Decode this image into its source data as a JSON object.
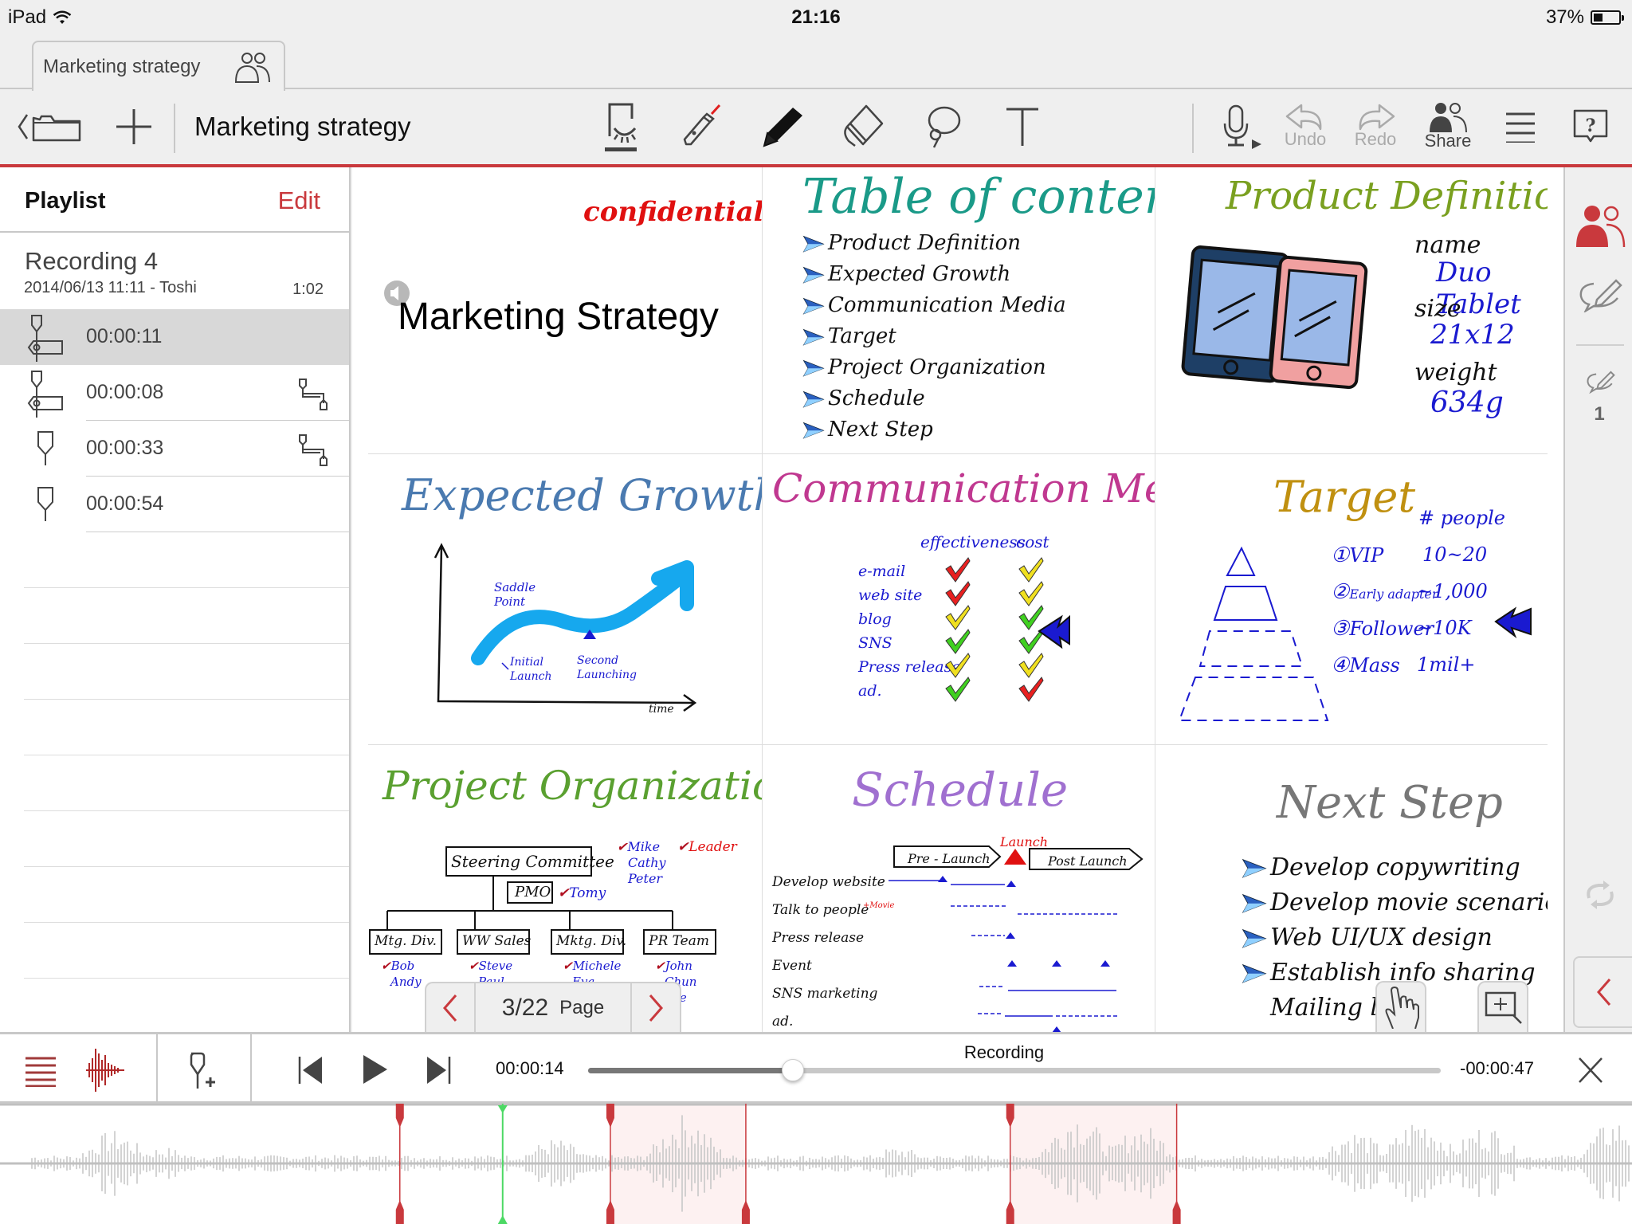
{
  "status_bar": {
    "device": "iPad",
    "time": "21:16",
    "battery_text": "37%",
    "battery_level": 0.37
  },
  "tab": {
    "title": "Marketing strategy"
  },
  "toolbar": {
    "title": "Marketing strategy",
    "undo_label": "Undo",
    "redo_label": "Redo",
    "share_label": "Share",
    "tools": [
      "view-mode",
      "laser-pointer",
      "pen",
      "eraser",
      "lasso",
      "text"
    ]
  },
  "playlist": {
    "title": "Playlist",
    "edit_label": "Edit",
    "recording": {
      "name": "Recording  4",
      "meta": "2014/06/13 11:11 - Toshi",
      "duration": "1:02"
    },
    "items": [
      {
        "time": "00:00:11",
        "icon": "bookmark-tag-icon",
        "trail": "",
        "selected": true
      },
      {
        "time": "00:00:08",
        "icon": "bookmark-tag-icon",
        "trail": "branch-icon",
        "selected": false
      },
      {
        "time": "00:00:33",
        "icon": "bookmark-icon",
        "trail": "branch-icon",
        "selected": false
      },
      {
        "time": "00:00:54",
        "icon": "bookmark-icon",
        "trail": "",
        "selected": false
      }
    ]
  },
  "slides": {
    "s1": {
      "confidential": "confidential",
      "title": "Marketing Strategy"
    },
    "s2": {
      "title": "Table of contents",
      "items": [
        "Product Definition",
        "Expected Growth",
        "Communication Media",
        "Target",
        "Project Organization",
        "Schedule",
        "Next Step"
      ]
    },
    "s3": {
      "title": "Product Definition",
      "name_label": "name",
      "name_value": "Duo Tablet",
      "size_label": "size",
      "size_value": "21x12",
      "weight_label": "weight",
      "weight_value": "634g"
    },
    "s4": {
      "title": "Expected Growth",
      "saddle": [
        "Saddle",
        "Point"
      ],
      "initial": [
        "Initial",
        "Launch"
      ],
      "second": [
        "Second",
        "Launching"
      ],
      "axis_x": "time"
    },
    "s5": {
      "title": "Communication Media",
      "col_effect": "effectiveness",
      "col_cost": "cost",
      "rows": [
        {
          "label": "e-mail",
          "effect": "red",
          "cost": "yellow"
        },
        {
          "label": "web site",
          "effect": "red",
          "cost": "yellow"
        },
        {
          "label": "blog",
          "effect": "yellow",
          "cost": "green"
        },
        {
          "label": "SNS",
          "effect": "green",
          "cost": "green"
        },
        {
          "label": "Press release",
          "effect": "yellow",
          "cost": "yellow"
        },
        {
          "label": "ad.",
          "effect": "green",
          "cost": "red"
        }
      ]
    },
    "s6": {
      "title": "Target",
      "col_people": "# people",
      "rows": [
        {
          "num": "①",
          "label": "VIP",
          "count": "10~20"
        },
        {
          "num": "②",
          "label": "Early adapter",
          "count": "~1,000"
        },
        {
          "num": "③",
          "label": "Follower",
          "count": "~10K"
        },
        {
          "num": "④",
          "label": "Mass",
          "count": "1mil+"
        }
      ]
    },
    "s7": {
      "title": "Project Organization",
      "steering": "Steering Committee",
      "steering_members": [
        "Mike",
        "Cathy",
        "Peter"
      ],
      "leader_legend": "Leader",
      "pmo": "PMO",
      "pmo_member": "Tomy",
      "teams": [
        {
          "name": "Mtg. Div.",
          "members": [
            "Bob",
            "Andy"
          ]
        },
        {
          "name": "WW Sales",
          "members": [
            "Steve",
            "Paul"
          ]
        },
        {
          "name": "Mktg. Div.",
          "members": [
            "Michele",
            "Eva"
          ]
        },
        {
          "name": "PR Team",
          "members": [
            "John",
            "Chun",
            "Lee"
          ]
        }
      ]
    },
    "s8": {
      "title": "Schedule",
      "launch": "Launch",
      "pre": "Pre - Launch",
      "post": "Post Launch",
      "tasks": [
        "Develop website",
        "Talk to people",
        "Press release",
        "Event",
        "SNS marketing",
        "ad."
      ],
      "movie_note": "+Movie"
    },
    "s9": {
      "title": "Next Step",
      "items": [
        "Develop copywriting",
        "Develop movie scenario",
        "Web UI/UX design",
        "Establish info sharing",
        "Mailing list"
      ]
    }
  },
  "page_nav": {
    "current": "3/22",
    "label": "Page"
  },
  "right_sidebar": {
    "comment_count": "1"
  },
  "player": {
    "current_time": "00:00:14",
    "remaining_time": "-00:00:47",
    "label": "Recording",
    "progress": 0.24
  },
  "waveform": {
    "markers": [
      {
        "type": "point",
        "position": 0.245,
        "color": "#c9393d"
      },
      {
        "type": "playhead",
        "position": 0.308,
        "color": "#4cd964"
      },
      {
        "type": "range",
        "start": 0.374,
        "end": 0.457,
        "color": "#c9393d"
      },
      {
        "type": "range",
        "start": 0.619,
        "end": 0.721,
        "color": "#c9393d"
      }
    ]
  },
  "colors": {
    "accent": "#c9393d",
    "ink_blue": "#1a1ad0",
    "playhead": "#4cd964"
  }
}
